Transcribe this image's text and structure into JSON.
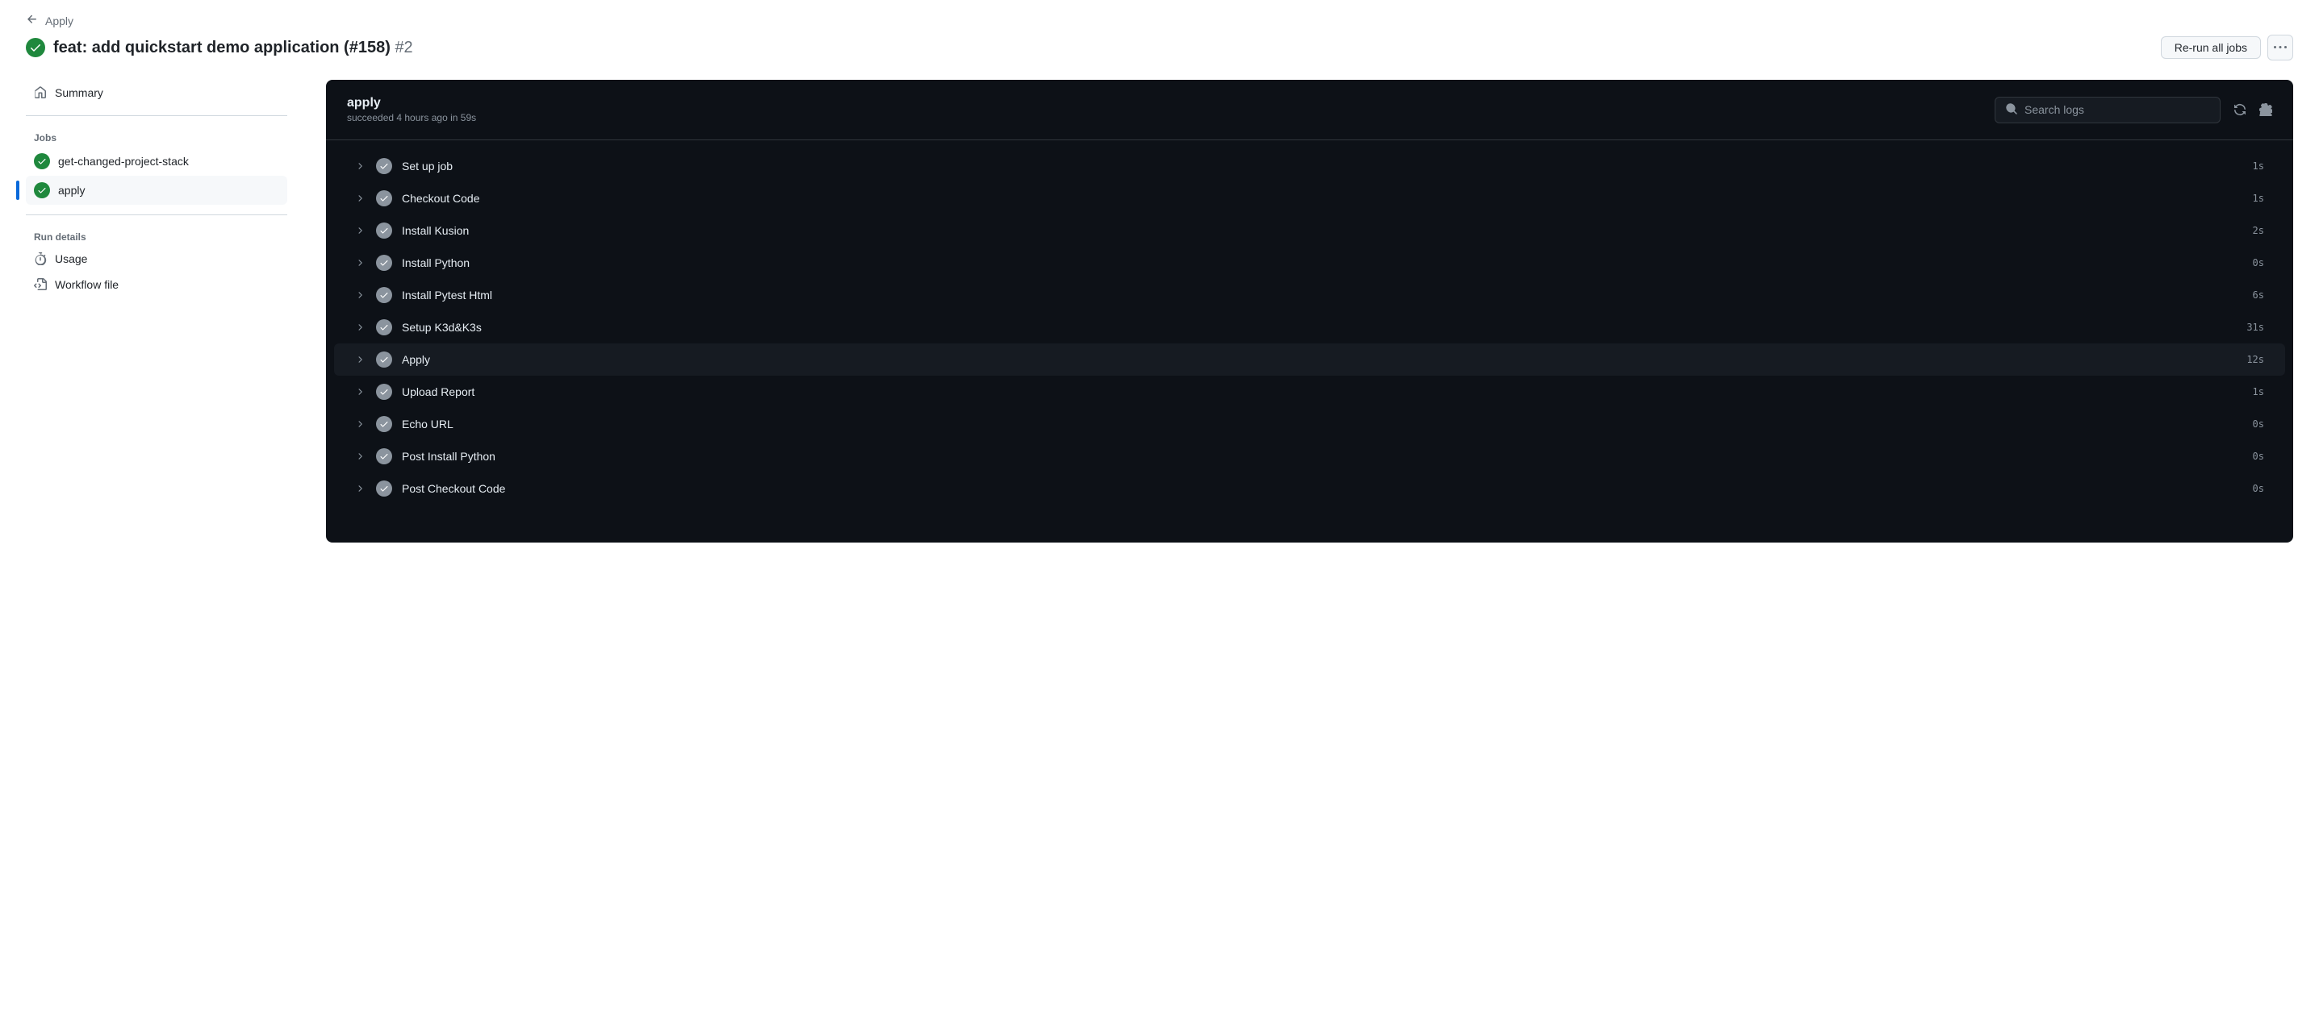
{
  "breadcrumb": {
    "parent": "Apply"
  },
  "title": {
    "text": "feat: add quickstart demo application (#158)",
    "run_number": "#2"
  },
  "actions": {
    "rerun_label": "Re-run all jobs"
  },
  "sidebar": {
    "summary_label": "Summary",
    "jobs_heading": "Jobs",
    "jobs": [
      {
        "name": "get-changed-project-stack",
        "active": false
      },
      {
        "name": "apply",
        "active": true
      }
    ],
    "run_details_heading": "Run details",
    "usage_label": "Usage",
    "workflow_file_label": "Workflow file"
  },
  "job": {
    "name": "apply",
    "status_text": "succeeded 4 hours ago in 59s",
    "search_placeholder": "Search logs",
    "steps": [
      {
        "name": "Set up job",
        "duration": "1s",
        "highlighted": false
      },
      {
        "name": "Checkout Code",
        "duration": "1s",
        "highlighted": false
      },
      {
        "name": "Install Kusion",
        "duration": "2s",
        "highlighted": false
      },
      {
        "name": "Install Python",
        "duration": "0s",
        "highlighted": false
      },
      {
        "name": "Install Pytest Html",
        "duration": "6s",
        "highlighted": false
      },
      {
        "name": "Setup K3d&K3s",
        "duration": "31s",
        "highlighted": false
      },
      {
        "name": "Apply",
        "duration": "12s",
        "highlighted": true
      },
      {
        "name": "Upload Report",
        "duration": "1s",
        "highlighted": false
      },
      {
        "name": "Echo URL",
        "duration": "0s",
        "highlighted": false
      },
      {
        "name": "Post Install Python",
        "duration": "0s",
        "highlighted": false
      },
      {
        "name": "Post Checkout Code",
        "duration": "0s",
        "highlighted": false
      }
    ]
  }
}
